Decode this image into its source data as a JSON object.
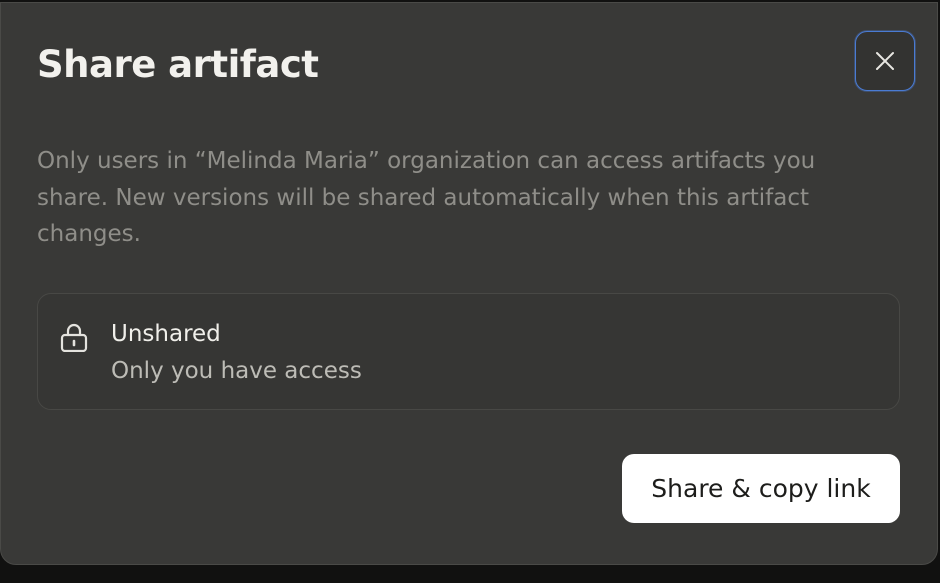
{
  "dialog": {
    "title": "Share artifact",
    "close_icon": "close-icon",
    "description": "Only users in “Melinda Maria” organization can access artifacts you share. New versions will be shared automatically when this artifact changes.",
    "access": {
      "icon": "lock-icon",
      "status": "Unshared",
      "detail": "Only you have access"
    },
    "share_button_label": "Share & copy link"
  },
  "colors": {
    "dialog_background": "#393937",
    "focus_ring": "#4a7bd3",
    "primary_button_background": "#ffffff"
  }
}
